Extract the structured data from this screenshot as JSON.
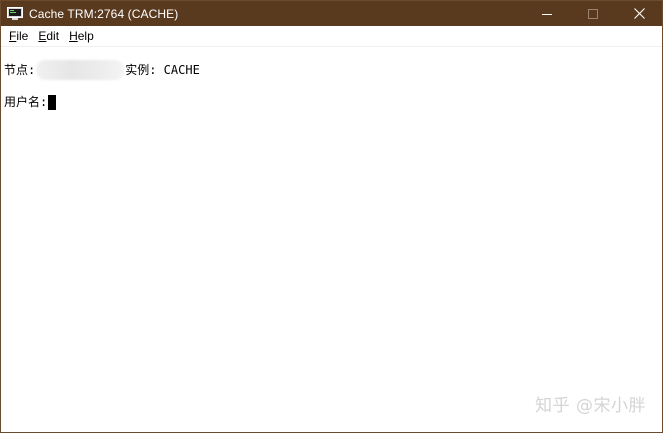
{
  "window": {
    "title": "Cache TRM:2764 (CACHE)",
    "titlebar_color": "#5a3a1f",
    "icon": "terminal-icon"
  },
  "menu": {
    "items": [
      {
        "accel": "F",
        "rest": "ile"
      },
      {
        "accel": "E",
        "rest": "dit"
      },
      {
        "accel": "H",
        "rest": "elp"
      }
    ]
  },
  "terminal": {
    "node_label": "节点:",
    "instance_label": "实例: CACHE",
    "username_prompt": "用户名:"
  },
  "watermark": {
    "text": "知乎 @宋小胖"
  }
}
